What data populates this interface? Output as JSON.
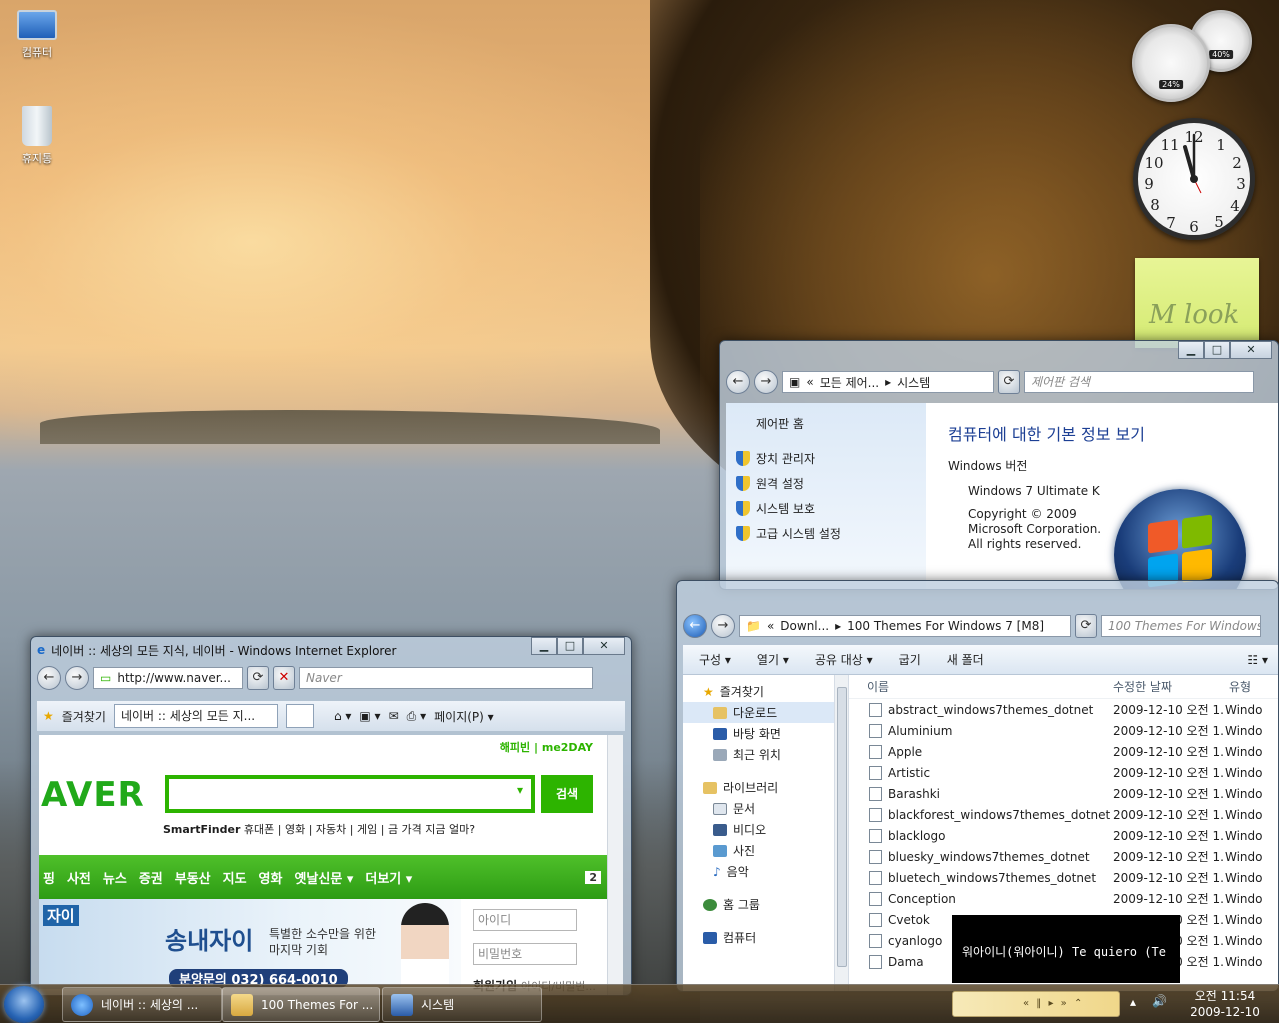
{
  "desktop": {
    "icons": [
      {
        "label": "컴퓨터",
        "icon": "computer-icon"
      },
      {
        "label": "휴지통",
        "icon": "recycle-bin-icon"
      }
    ]
  },
  "gadgets": {
    "cpu_percent": "24%",
    "memory_percent": "40%",
    "clock_numbers": [
      "12",
      "1",
      "2",
      "3",
      "4",
      "5",
      "6",
      "7",
      "8",
      "9",
      "10",
      "11"
    ],
    "note_text": "M look"
  },
  "system_window": {
    "breadcrumb": [
      "모든 제어...",
      "시스템"
    ],
    "search_placeholder": "제어판 검색",
    "side_home": "제어판 홈",
    "side_links": [
      "장치 관리자",
      "원격 설정",
      "시스템 보호",
      "고급 시스템 설정"
    ],
    "heading": "컴퓨터에 대한 기본 정보 보기",
    "section": "Windows 버전",
    "edition": "Windows 7 Ultimate K",
    "copyright": [
      "Copyright © 2009",
      "Microsoft Corporation.",
      "All rights reserved."
    ]
  },
  "explorer": {
    "breadcrumb": [
      "Downl...",
      "100 Themes For Windows 7 [M8]"
    ],
    "search_placeholder": "100 Themes For Windows 7 [M",
    "commands": [
      "구성 ▾",
      "열기 ▾",
      "공유 대상 ▾",
      "굽기",
      "새 폴더"
    ],
    "nav": {
      "favorites": "즐겨찾기",
      "fav_items": [
        "다운로드",
        "바탕 화면",
        "최근 위치"
      ],
      "libraries": "라이브러리",
      "lib_items": [
        "문서",
        "비디오",
        "사진",
        "음악"
      ],
      "homegroup": "홈 그룹",
      "computer": "컴퓨터"
    },
    "columns": [
      "이름",
      "수정한 날짜",
      "유형"
    ],
    "files": [
      {
        "name": "abstract_windows7themes_dotnet",
        "date": "2009-12-10 오전 1...",
        "type": "Windo"
      },
      {
        "name": "Aluminium",
        "date": "2009-12-10 오전 1...",
        "type": "Windo"
      },
      {
        "name": "Apple",
        "date": "2009-12-10 오전 1...",
        "type": "Windo"
      },
      {
        "name": "Artistic",
        "date": "2009-12-10 오전 1...",
        "type": "Windo"
      },
      {
        "name": "Barashki",
        "date": "2009-12-10 오전 1...",
        "type": "Windo"
      },
      {
        "name": "blackforest_windows7themes_dotnet",
        "date": "2009-12-10 오전 1...",
        "type": "Windo"
      },
      {
        "name": "blacklogo",
        "date": "2009-12-10 오전 1...",
        "type": "Windo"
      },
      {
        "name": "bluesky_windows7themes_dotnet",
        "date": "2009-12-10 오전 1...",
        "type": "Windo"
      },
      {
        "name": "bluetech_windows7themes_dotnet",
        "date": "2009-12-10 오전 1...",
        "type": "Windo"
      },
      {
        "name": "Conception",
        "date": "2009-12-10 오전 1...",
        "type": "Windo"
      },
      {
        "name": "Cvetok",
        "date": "2009-12-10 오전 1...",
        "type": "Windo"
      },
      {
        "name": "cyanlogo",
        "date": "2009-12-10 오전 1...",
        "type": "Windo"
      },
      {
        "name": "Dama",
        "date": "2009-12-10 오전 1...",
        "type": "Windo"
      }
    ],
    "tooltip": "워아이니(워아이니) Te quiero (Te"
  },
  "ie": {
    "title": "네이버 :: 세상의 모든 지식, 네이버 - Windows Internet Explorer",
    "address": "http://www.naver...",
    "search_placeholder": "Naver",
    "favorites": "즐겨찾기",
    "tab_title": "네이버 :: 세상의 모든 지...",
    "page_menu": "페이지(P) ▾",
    "naver": {
      "links_top": [
        "해피빈",
        "me2DAY"
      ],
      "logo": "AVER",
      "search_button": "검색",
      "smartfinder": "SmartFinder",
      "finder_links": [
        "휴대폰",
        "영화",
        "자동차",
        "게임",
        "금 가격 지금 얼마?"
      ],
      "menu": [
        "핑",
        "사전",
        "뉴스",
        "증권",
        "부동산",
        "지도",
        "영화",
        "옛날신문 ▾",
        "더보기 ▾"
      ],
      "menu_badge": "2",
      "banner_left": "자이",
      "banner_title": "송내자이",
      "banner_sub": [
        "특별한 소수만을 위한",
        "마지막 기회"
      ],
      "banner_phone": "분양문의  032) 664-0010",
      "login_id": "아이디",
      "login_pw": "비밀번호",
      "signup": "회원가입",
      "find": "아이디/비밀번..."
    }
  },
  "taskbar": {
    "items": [
      "네이버 :: 세상의 ...",
      "100 Themes For ...",
      "시스템"
    ],
    "time": "오전 11:54",
    "date": "2009-12-10"
  }
}
